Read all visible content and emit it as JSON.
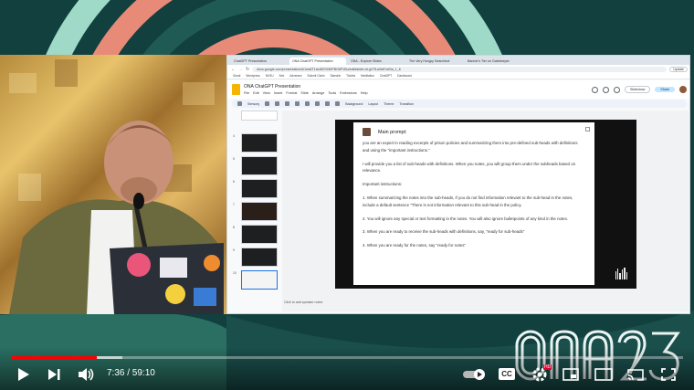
{
  "browser": {
    "tabs": [
      {
        "label": "ChatGPT Presentation",
        "active": false
      },
      {
        "label": "ONA ChatGPT Presentation",
        "active": true
      },
      {
        "label": "ONA - Explore Slides",
        "active": false
      },
      {
        "label": "The Very Hungry Searchbot",
        "active": false
      },
      {
        "label": "Banner's Tier on Gatekeeper",
        "active": false
      }
    ],
    "url": "docs.google.com/presentation/d/1ws6T1sIuB0YIM0PBG6P1Bu/edit#slide=id.g27f1a3b67a93a_1_6",
    "bookmarks": [
      "Gmail",
      "Wordpress",
      "NVSU",
      "Smt",
      "Adverses",
      "Submit Claim",
      "Starsinh",
      "Tickets",
      "Meditation",
      "ChatGPT",
      "Dashboard"
    ],
    "update_label": "Update"
  },
  "app": {
    "doc_title": "ONA ChatGPT Presentation",
    "menus": [
      "File",
      "Edit",
      "View",
      "Insert",
      "Format",
      "Slide",
      "Arrange",
      "Tools",
      "Extensions",
      "Help"
    ],
    "slideshow_label": "Slideshow",
    "share_label": "Share",
    "toolbar": {
      "zoom": "Sensory",
      "background": "Background",
      "layout": "Layout",
      "theme": "Theme",
      "transition": "Transition"
    },
    "slide_numbers": [
      "",
      "4",
      "5",
      "6",
      "7",
      "8",
      "9",
      "10"
    ],
    "speaker_notes": "Click to add speaker notes"
  },
  "slide": {
    "header": "Main prompt:",
    "paragraphs": [
      "you are an expert in reading excerpts of prison policies and summarizing them into pre-defined sub-heads with definitions and using the \"important instructions.\"",
      "I will provide you a list of sub-heads with definitions. When you notes, you will group them under the subheads based on relevance.",
      "Important instructions:",
      "1. When summarizing the notes into the sub-heads, if you do not find information relevant to the sub-head in the notes, include a default sentence \"There is not information relevant to this sub-head in the policy.",
      "2. You will ignore any special or text formatting in the notes. You will also ignore bulletpoints of any kind in the notes.",
      "3. When you are ready to receive the sub-heads with definitions, say, \"ready for sub-heads\"",
      "4. When you are ready for the notes, say \"ready for notes\""
    ]
  },
  "player": {
    "current_time": "7:36",
    "duration": "59:10",
    "time_display": "7:36 / 59:10",
    "progress_fraction": 0.128,
    "buffered_fraction": 0.166,
    "hd_badge": "HD",
    "cc_label": "CC",
    "accent": "#ff0000"
  },
  "event_logo": {
    "text": "ONA23",
    "color": "#eaf4f2"
  },
  "colors": {
    "teal_dark": "#0f3a3c",
    "salmon": "#e88a78",
    "mint": "#9fd9c7"
  }
}
